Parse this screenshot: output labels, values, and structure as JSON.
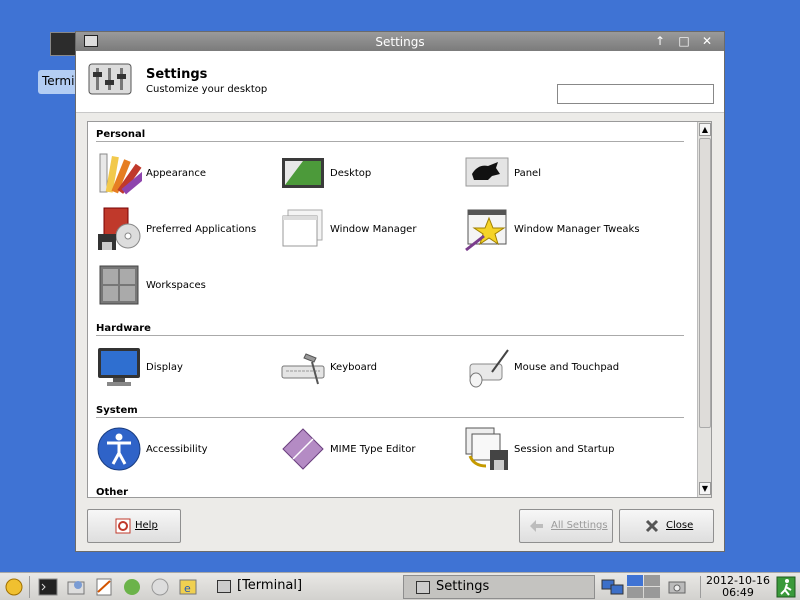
{
  "desktop": {
    "icon_label": "Termi"
  },
  "window": {
    "title": "Settings",
    "header_title": "Settings",
    "header_subtitle": "Customize your desktop",
    "search_value": ""
  },
  "sections": [
    {
      "title": "Personal",
      "items": [
        {
          "label": "Appearance",
          "icon": "appearance-icon"
        },
        {
          "label": "Desktop",
          "icon": "desktop-icon"
        },
        {
          "label": "Panel",
          "icon": "panel-icon"
        },
        {
          "label": "Preferred Applications",
          "icon": "preferred-applications-icon"
        },
        {
          "label": "Window Manager",
          "icon": "window-manager-icon"
        },
        {
          "label": "Window Manager Tweaks",
          "icon": "window-manager-tweaks-icon"
        },
        {
          "label": "Workspaces",
          "icon": "workspaces-icon"
        }
      ]
    },
    {
      "title": "Hardware",
      "items": [
        {
          "label": "Display",
          "icon": "display-icon"
        },
        {
          "label": "Keyboard",
          "icon": "keyboard-icon"
        },
        {
          "label": "Mouse and Touchpad",
          "icon": "mouse-icon"
        }
      ]
    },
    {
      "title": "System",
      "items": [
        {
          "label": "Accessibility",
          "icon": "accessibility-icon"
        },
        {
          "label": "MIME Type Editor",
          "icon": "mime-type-editor-icon"
        },
        {
          "label": "Session and Startup",
          "icon": "session-startup-icon"
        }
      ]
    },
    {
      "title": "Other",
      "items": []
    }
  ],
  "buttons": {
    "help": "Help",
    "all_settings": "All Settings",
    "close": "Close"
  },
  "taskbar": {
    "tasks": [
      {
        "label": "[Terminal]",
        "active": false
      },
      {
        "label": "Settings",
        "active": true
      }
    ],
    "clock_date": "2012-10-16",
    "clock_time": "06:49"
  },
  "colors": {
    "desktop": "#3f73d4",
    "titlebar": "#8a8a8a",
    "content": "#ffffff"
  }
}
